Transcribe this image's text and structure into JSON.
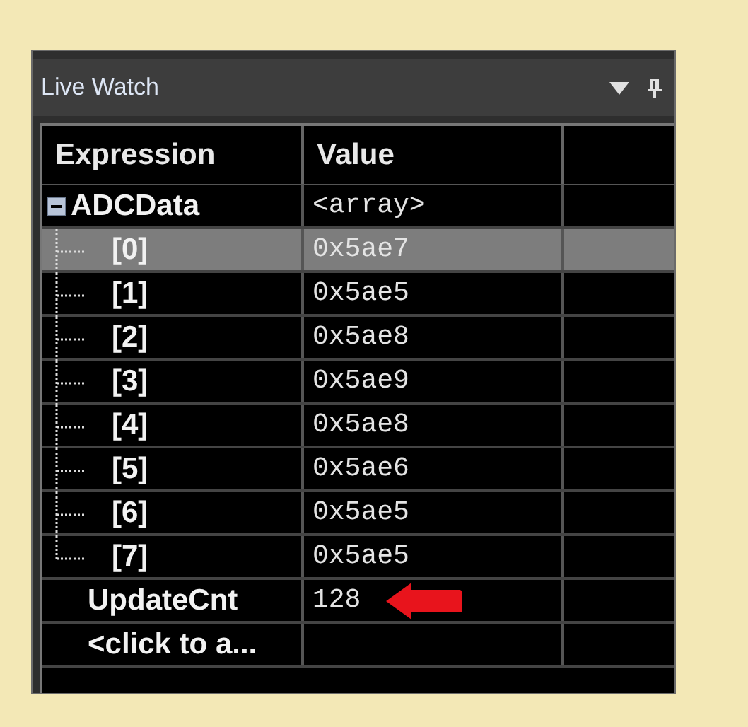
{
  "window": {
    "title": "Live Watch"
  },
  "table": {
    "columns": [
      "Expression",
      "Value"
    ],
    "rows": [
      {
        "expression": "ADCData",
        "value": "<array>",
        "expanded": true,
        "selected": false,
        "children": [
          {
            "expression": "[0]",
            "value": "0x5ae7",
            "selected": true
          },
          {
            "expression": "[1]",
            "value": "0x5ae5",
            "selected": false
          },
          {
            "expression": "[2]",
            "value": "0x5ae8",
            "selected": false
          },
          {
            "expression": "[3]",
            "value": "0x5ae9",
            "selected": false
          },
          {
            "expression": "[4]",
            "value": "0x5ae8",
            "selected": false
          },
          {
            "expression": "[5]",
            "value": "0x5ae6",
            "selected": false
          },
          {
            "expression": "[6]",
            "value": "0x5ae5",
            "selected": false
          },
          {
            "expression": "[7]",
            "value": "0x5ae5",
            "selected": false
          }
        ]
      },
      {
        "expression": "UpdateCnt",
        "value": "128",
        "selected": false
      },
      {
        "expression": "<click to a...",
        "selected": false
      }
    ]
  }
}
